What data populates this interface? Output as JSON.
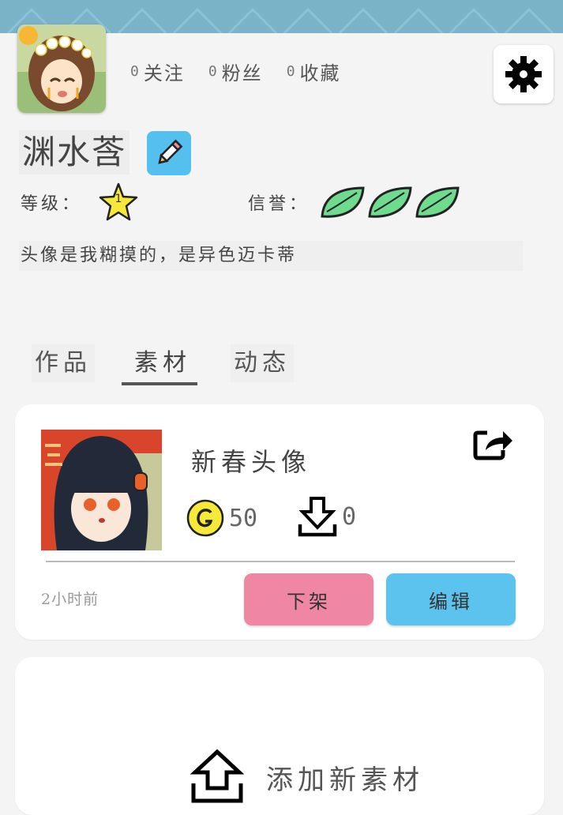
{
  "profile": {
    "stats": [
      {
        "num": "0",
        "label": "关注"
      },
      {
        "num": "0",
        "label": "粉丝"
      },
      {
        "num": "0",
        "label": "收藏"
      }
    ],
    "username": "渊水莟",
    "level_label": "等级：",
    "level_value": "1",
    "credit_label": "信誉：",
    "credit_leaves": 3,
    "bio": "头像是我糊摸的，是异色迈卡蒂"
  },
  "icons": {
    "settings": "gear-icon",
    "edit_name": "pencil-icon",
    "level": "star-icon",
    "credit": "leaf-icon",
    "share": "share-icon",
    "coin": "coin-icon",
    "download": "download-icon",
    "add": "upload-icon"
  },
  "tabs": [
    {
      "label": "作品",
      "active": false
    },
    {
      "label": "素材",
      "active": true
    },
    {
      "label": "动态",
      "active": false
    }
  ],
  "material": {
    "title": "新春头像",
    "price": "50",
    "downloads": "0",
    "time": "2小时前",
    "unlist_label": "下架",
    "edit_label": "编辑"
  },
  "add_material": {
    "label": "添加新素材"
  },
  "colors": {
    "header_strip": "#7ab3c8",
    "background": "#f4f4f4",
    "edit_button": "#5cc3ee",
    "unlist_button": "#ef86a3",
    "leaf": "#6edb8f",
    "star": "#f6e93a",
    "coin": "#f6e93a"
  }
}
